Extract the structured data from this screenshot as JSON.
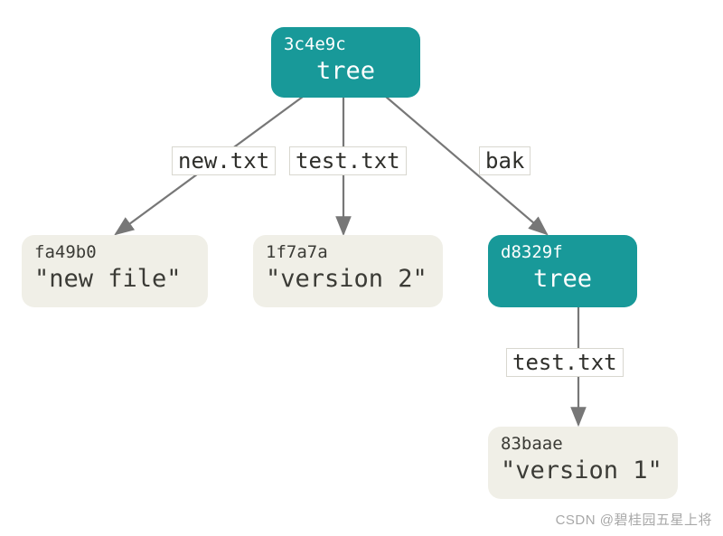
{
  "nodes": {
    "root": {
      "hash": "3c4e9c",
      "label": "tree"
    },
    "blob1": {
      "hash": "fa49b0",
      "label": "\"new file\""
    },
    "blob2": {
      "hash": "1f7a7a",
      "label": "\"version 2\""
    },
    "subtree": {
      "hash": "d8329f",
      "label": "tree"
    },
    "blob3": {
      "hash": "83baae",
      "label": "\"version 1\""
    }
  },
  "edges": {
    "e1": "new.txt",
    "e2": "test.txt",
    "e3": "bak",
    "e4": "test.txt"
  },
  "watermark": "CSDN @碧桂园五星上将"
}
